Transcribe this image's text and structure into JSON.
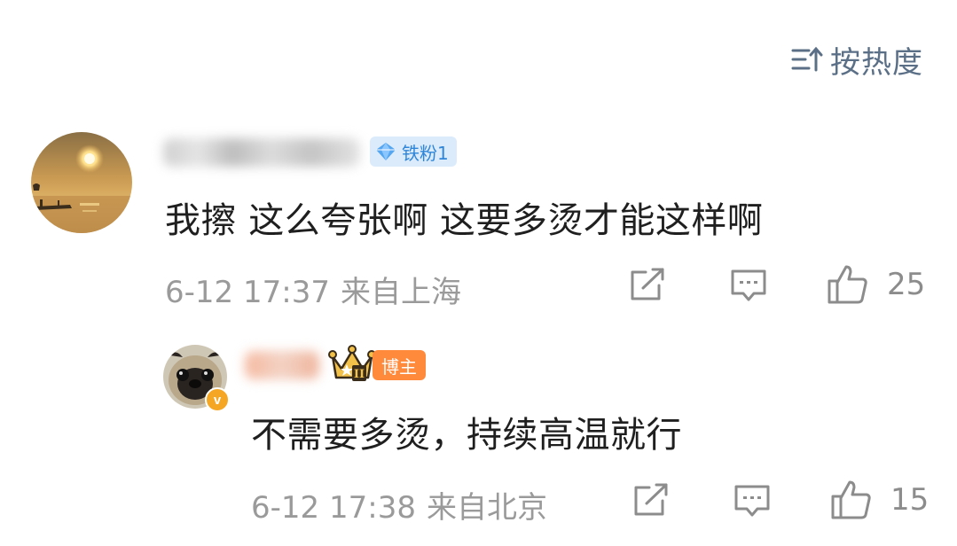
{
  "sort": {
    "label": "按热度",
    "icon": "sort-lines-arrow-up"
  },
  "comments": [
    {
      "username": "",
      "fan_badge": "铁粉1",
      "text": "我擦 这么夸张啊 这要多烫才能这样啊",
      "date": "6-12 17:37",
      "location": "来自上海",
      "likes": "25",
      "icons": {
        "share": "share-icon",
        "reply": "comment-icon",
        "like": "thumbs-up-icon"
      }
    },
    {
      "username": "",
      "crown_badge": "II",
      "role_badge": "博主",
      "verified": "v",
      "text": "不需要多烫，持续高温就行",
      "date": "6-12 17:38",
      "location": "来自北京",
      "likes": "15",
      "icons": {
        "share": "share-icon",
        "reply": "comment-icon",
        "like": "thumbs-up-icon"
      }
    }
  ],
  "colors": {
    "sort_text": "#5b7087",
    "fan_badge_bg": "#dcebfb",
    "fan_badge_text": "#2f86d8",
    "host_badge_bg": "#ff8a3c",
    "verified_badge": "#f5a623",
    "meta_text": "#9a9a9a"
  }
}
